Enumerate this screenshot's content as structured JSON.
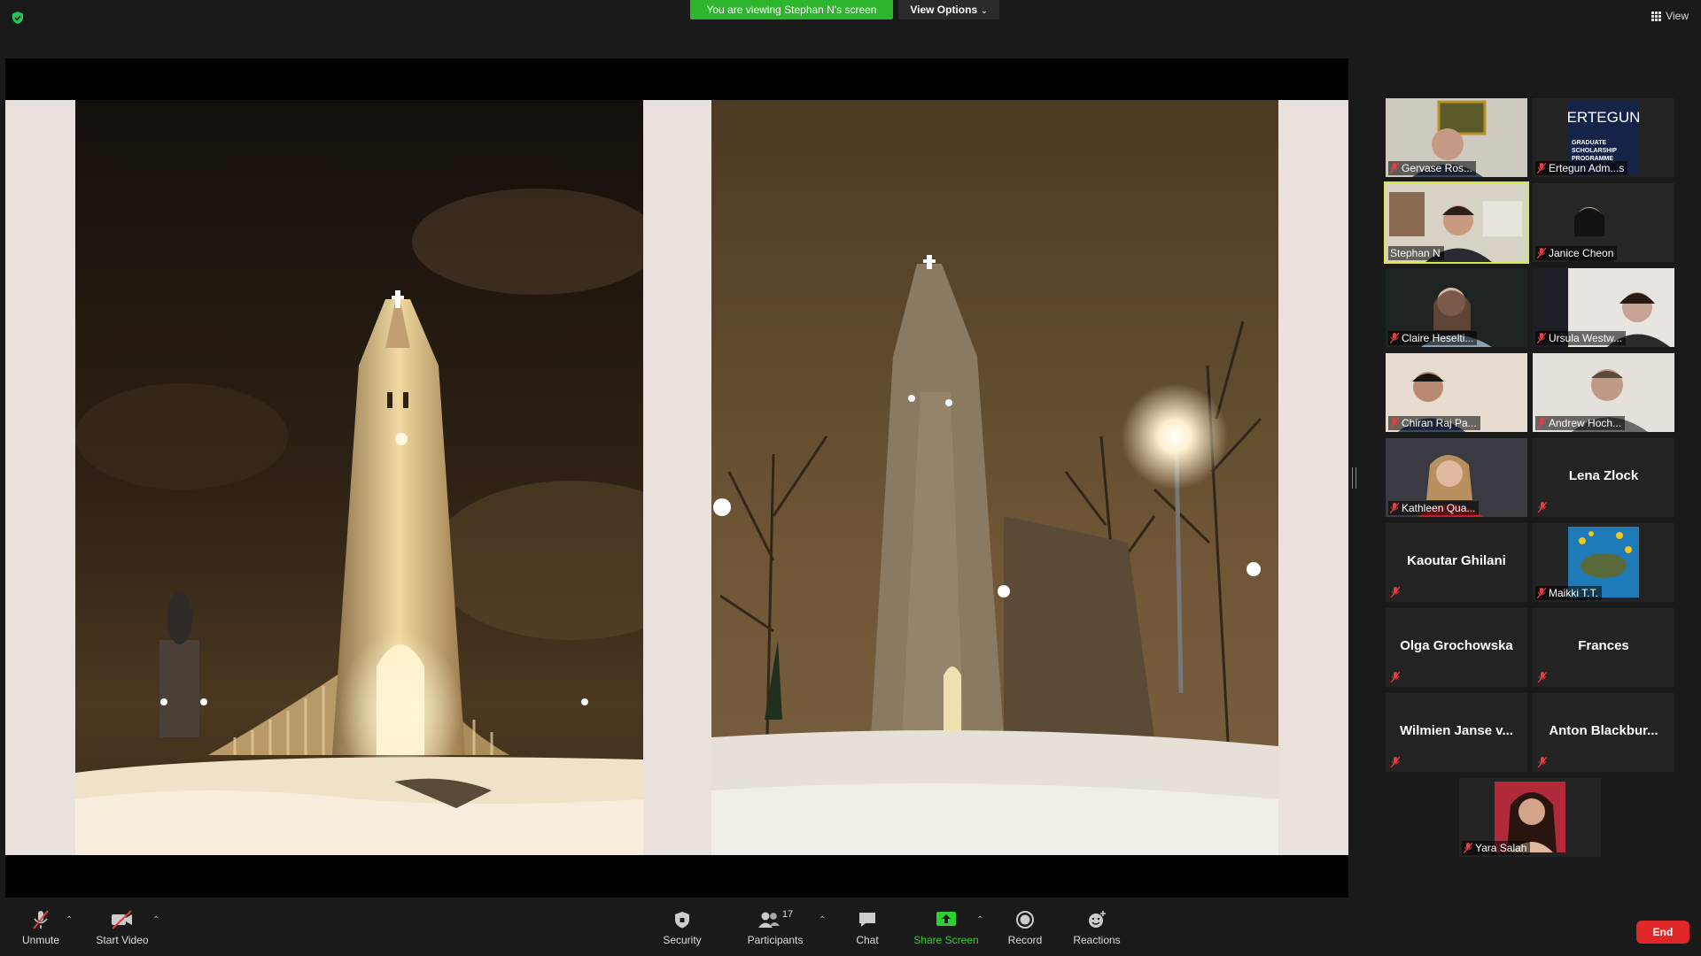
{
  "banner": {
    "viewing_text": "You are viewing Stephan N's screen",
    "view_options_label": "View Options",
    "view_label": "View"
  },
  "participants": [
    {
      "name": "Gervase Ros...",
      "video": true
    },
    {
      "name": "Ertegun Adm...s",
      "video": true
    },
    {
      "name": "Stephan N",
      "video": true,
      "active_speaker": true
    },
    {
      "name": "Janice Cheon",
      "video": true
    },
    {
      "name": "Claire Heselti...",
      "video": true
    },
    {
      "name": "Ursula Westw...",
      "video": true
    },
    {
      "name": "Chiran Raj Pa...",
      "video": true
    },
    {
      "name": "Andrew Hoch...",
      "video": true
    },
    {
      "name": "Kathleen Qua...",
      "video": true
    },
    {
      "name": "Lena Zlock",
      "video": false
    },
    {
      "name": "Kaoutar Ghilani",
      "video": false
    },
    {
      "name": "Maikki T.T.",
      "video": true
    },
    {
      "name": "Olga Grochowska",
      "video": false
    },
    {
      "name": "Frances",
      "video": false
    },
    {
      "name": "Wilmien Janse v...",
      "video": false
    },
    {
      "name": "Anton Blackbur...",
      "video": false
    },
    {
      "name": "Yara Salah",
      "video": true
    }
  ],
  "ertegun_logo": {
    "title": "ERTEGUN",
    "line1": "GRADUATE",
    "line2": "SCHOLARSHIP",
    "line3": "PROGRAMME"
  },
  "toolbar": {
    "unmute": "Unmute",
    "start_video": "Start Video",
    "security": "Security",
    "participants": "Participants",
    "participants_count": "17",
    "chat": "Chat",
    "share_screen": "Share Screen",
    "record": "Record",
    "reactions": "Reactions",
    "end": "End"
  },
  "colors": {
    "banner_green": "#2db52d",
    "active_outline": "#d6e84a",
    "share_green": "#2fcf2f",
    "end_red": "#e02828",
    "muted_red": "#e04040"
  },
  "icons": [
    "shield-icon",
    "grid-icon",
    "mic-muted-icon",
    "video-off-icon",
    "security-shield-icon",
    "participants-icon",
    "chat-icon",
    "share-screen-icon",
    "record-icon",
    "reactions-icon"
  ]
}
